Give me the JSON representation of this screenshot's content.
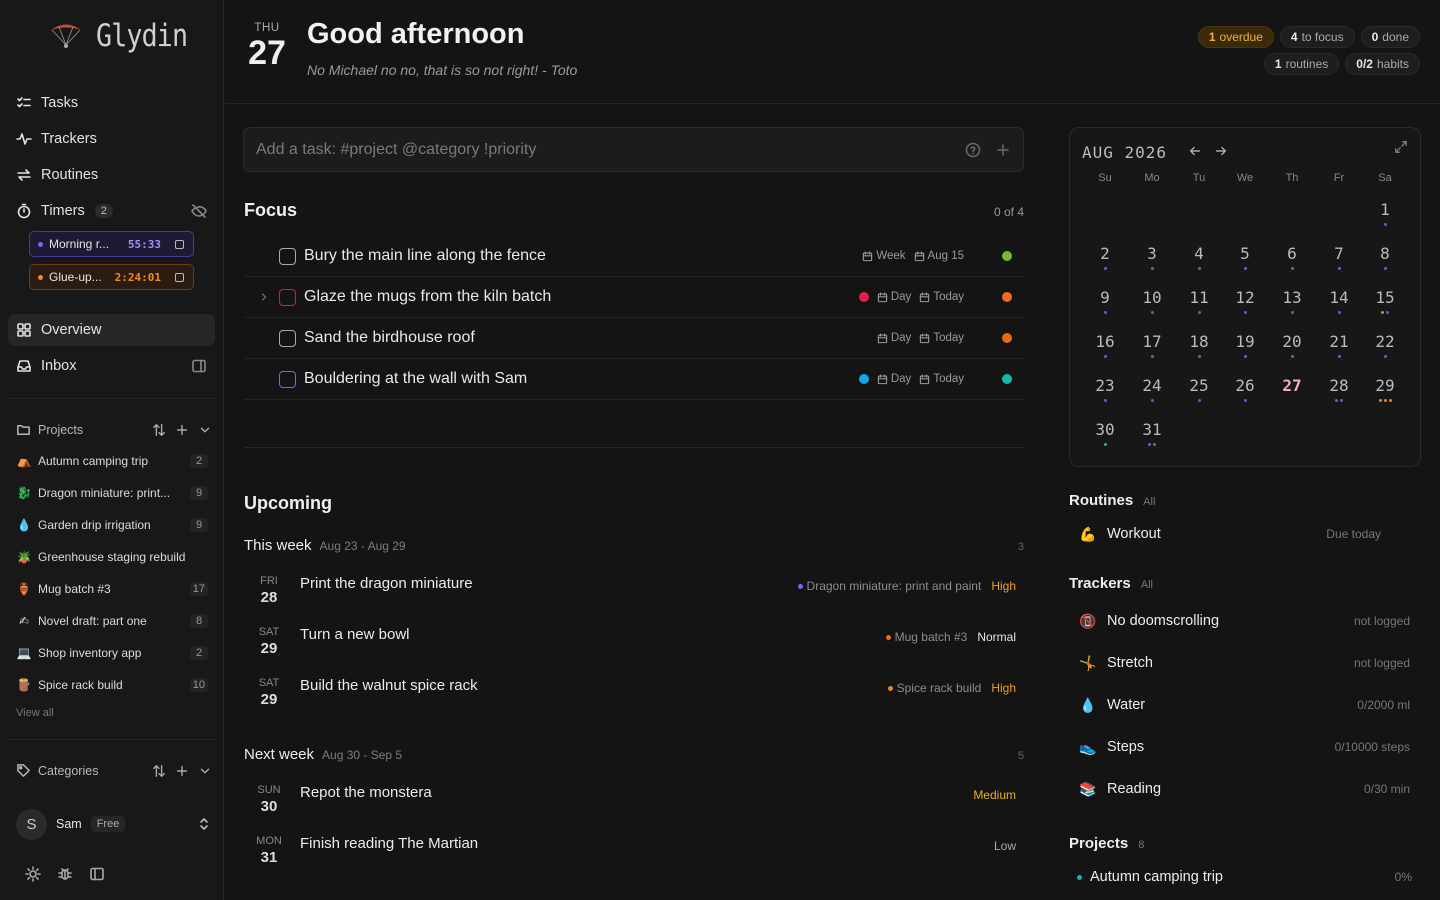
{
  "app": {
    "name": "Glydin"
  },
  "nav": {
    "tasks": "Tasks",
    "trackers": "Trackers",
    "routines": "Routines",
    "timers": "Timers",
    "timers_count": "2",
    "overview": "Overview",
    "inbox": "Inbox"
  },
  "timers": [
    {
      "name": "Morning r...",
      "time": "55:33",
      "color": "#8b5cf6"
    },
    {
      "name": "Glue-up...",
      "time": "2:24:01",
      "color": "#f08a24"
    }
  ],
  "sidebar": {
    "projects_label": "Projects",
    "projects": [
      {
        "emoji": "⛺",
        "name": "Autumn camping trip",
        "count": "2"
      },
      {
        "emoji": "🐉",
        "name": "Dragon miniature: print...",
        "count": "9"
      },
      {
        "emoji": "💧",
        "name": "Garden drip irrigation",
        "count": "9"
      },
      {
        "emoji": "🪴",
        "name": "Greenhouse staging rebuild",
        "count": ""
      },
      {
        "emoji": "🏺",
        "name": "Mug batch #3",
        "count": "17"
      },
      {
        "emoji": "✍",
        "name": "Novel draft: part one",
        "count": "8"
      },
      {
        "emoji": "💻",
        "name": "Shop inventory app",
        "count": "2"
      },
      {
        "emoji": "🪵",
        "name": "Spice rack build",
        "count": "10"
      }
    ],
    "view_all": "View all",
    "categories_label": "Categories"
  },
  "user": {
    "initial": "S",
    "name": "Sam",
    "plan": "Free"
  },
  "header": {
    "weekday": "THU",
    "day": "27",
    "greeting": "Good afternoon",
    "quote": "No Michael no no, that is so not right! - Toto",
    "pills": {
      "overdue_n": "1",
      "overdue_l": "overdue",
      "focus_n": "4",
      "focus_l": "to focus",
      "done_n": "0",
      "done_l": "done",
      "routines_n": "1",
      "routines_l": "routines",
      "habits_n": "0/2",
      "habits_l": "habits"
    }
  },
  "add_task": {
    "placeholder": "Add a task: #project @category !priority"
  },
  "focus": {
    "title": "Focus",
    "count": "0 of 4",
    "tasks": [
      {
        "title": "Bury the main line along the fence",
        "when": "Week",
        "date": "Aug 15",
        "dot": "",
        "prio": "#7cb82f",
        "cb": "#aaaaaa",
        "chev": false
      },
      {
        "title": "Glaze the mugs from the kiln batch",
        "when": "Day",
        "date": "Today",
        "dot": "#e81e4a",
        "prio": "#f26b1d",
        "cb": "#c2283a",
        "chev": true
      },
      {
        "title": "Sand the birdhouse roof",
        "when": "Day",
        "date": "Today",
        "dot": "",
        "prio": "#e86a14",
        "cb": "#aaaaaa",
        "chev": false
      },
      {
        "title": "Bouldering at the wall with Sam",
        "when": "Day",
        "date": "Today",
        "dot": "#0ea5e9",
        "prio": "#14b8a6",
        "cb": "#3b82f6",
        "chev": false
      }
    ]
  },
  "upcoming": {
    "title": "Upcoming",
    "groups": [
      {
        "title": "This week",
        "range": "Aug 23 - Aug 29",
        "count": "3",
        "items": [
          {
            "wd": "FRI",
            "dn": "28",
            "title": "Print the dragon miniature",
            "project": "Dragon miniature: print and paint",
            "pcolor": "#8b5cf6",
            "prio": "High",
            "prioColor": "#f0a020"
          },
          {
            "wd": "SAT",
            "dn": "29",
            "title": "Turn a new bowl",
            "project": "Mug batch #3",
            "pcolor": "#f26b1d",
            "prio": "Normal",
            "prioColor": "#e6e6e6"
          },
          {
            "wd": "SAT",
            "dn": "29",
            "title": "Build the walnut spice rack",
            "project": "Spice rack build",
            "pcolor": "#e8852a",
            "prio": "High",
            "prioColor": "#f0a020"
          }
        ]
      },
      {
        "title": "Next week",
        "range": "Aug 30 - Sep 5",
        "count": "5",
        "items": [
          {
            "wd": "SUN",
            "dn": "30",
            "title": "Repot the monstera",
            "project": "",
            "pcolor": "",
            "prio": "Medium",
            "prioColor": "#e8b020"
          },
          {
            "wd": "MON",
            "dn": "31",
            "title": "Finish reading The Martian",
            "project": "",
            "pcolor": "",
            "prio": "Low",
            "prioColor": "#aaaaaa"
          }
        ]
      }
    ]
  },
  "calendar": {
    "month": "AUG 2026",
    "weekdays": [
      "Su",
      "Mo",
      "Tu",
      "We",
      "Th",
      "Fr",
      "Sa"
    ],
    "first_weekday": 6,
    "days": 31,
    "today": 27,
    "dots": {
      "1": [
        "#6d5bd0"
      ],
      "2": [
        "#6d5bd0"
      ],
      "3": [
        "#6d5bd0"
      ],
      "4": [
        "#6d5bd0"
      ],
      "5": [
        "#6d5bd0"
      ],
      "6": [
        "#6d5bd0"
      ],
      "7": [
        "#6d5bd0"
      ],
      "8": [
        "#6d5bd0"
      ],
      "9": [
        "#6d5bd0"
      ],
      "10": [
        "#6d5bd0"
      ],
      "11": [
        "#6d5bd0"
      ],
      "12": [
        "#6d5bd0"
      ],
      "13": [
        "#6d5bd0"
      ],
      "14": [
        "#6d5bd0"
      ],
      "15": [
        "#7cb82f",
        "#6d5bd0"
      ],
      "16": [
        "#6d5bd0"
      ],
      "17": [
        "#6d5bd0"
      ],
      "18": [
        "#6d5bd0"
      ],
      "19": [
        "#6d5bd0"
      ],
      "20": [
        "#6d5bd0"
      ],
      "21": [
        "#6d5bd0"
      ],
      "22": [
        "#6d5bd0"
      ],
      "23": [
        "#6d5bd0"
      ],
      "24": [
        "#6d5bd0"
      ],
      "25": [
        "#6d5bd0"
      ],
      "26": [
        "#6d5bd0"
      ],
      "28": [
        "#6d5bd0",
        "#6d5bd0"
      ],
      "29": [
        "#e8852a",
        "#e8852a",
        "#e8852a"
      ],
      "30": [
        "#14b8a6"
      ],
      "31": [
        "#6d5bd0",
        "#6d5bd0"
      ]
    }
  },
  "routines": {
    "title": "Routines",
    "all": "All",
    "items": [
      {
        "emoji": "💪",
        "name": "Workout",
        "value": "Due today"
      }
    ]
  },
  "trackers": {
    "title": "Trackers",
    "all": "All",
    "items": [
      {
        "emoji": "📵",
        "name": "No doomscrolling",
        "value": "not logged"
      },
      {
        "emoji": "🤸",
        "name": "Stretch",
        "value": "not logged"
      },
      {
        "emoji": "💧",
        "name": "Water",
        "value": "0/2000 ml"
      },
      {
        "emoji": "👟",
        "name": "Steps",
        "value": "0/10000 steps"
      },
      {
        "emoji": "📚",
        "name": "Reading",
        "value": "0/30 min"
      }
    ]
  },
  "projects_panel": {
    "title": "Projects",
    "count": "8",
    "items": [
      {
        "name": "Autumn camping trip",
        "pct": "0%",
        "color": "#14b8a6"
      }
    ]
  }
}
